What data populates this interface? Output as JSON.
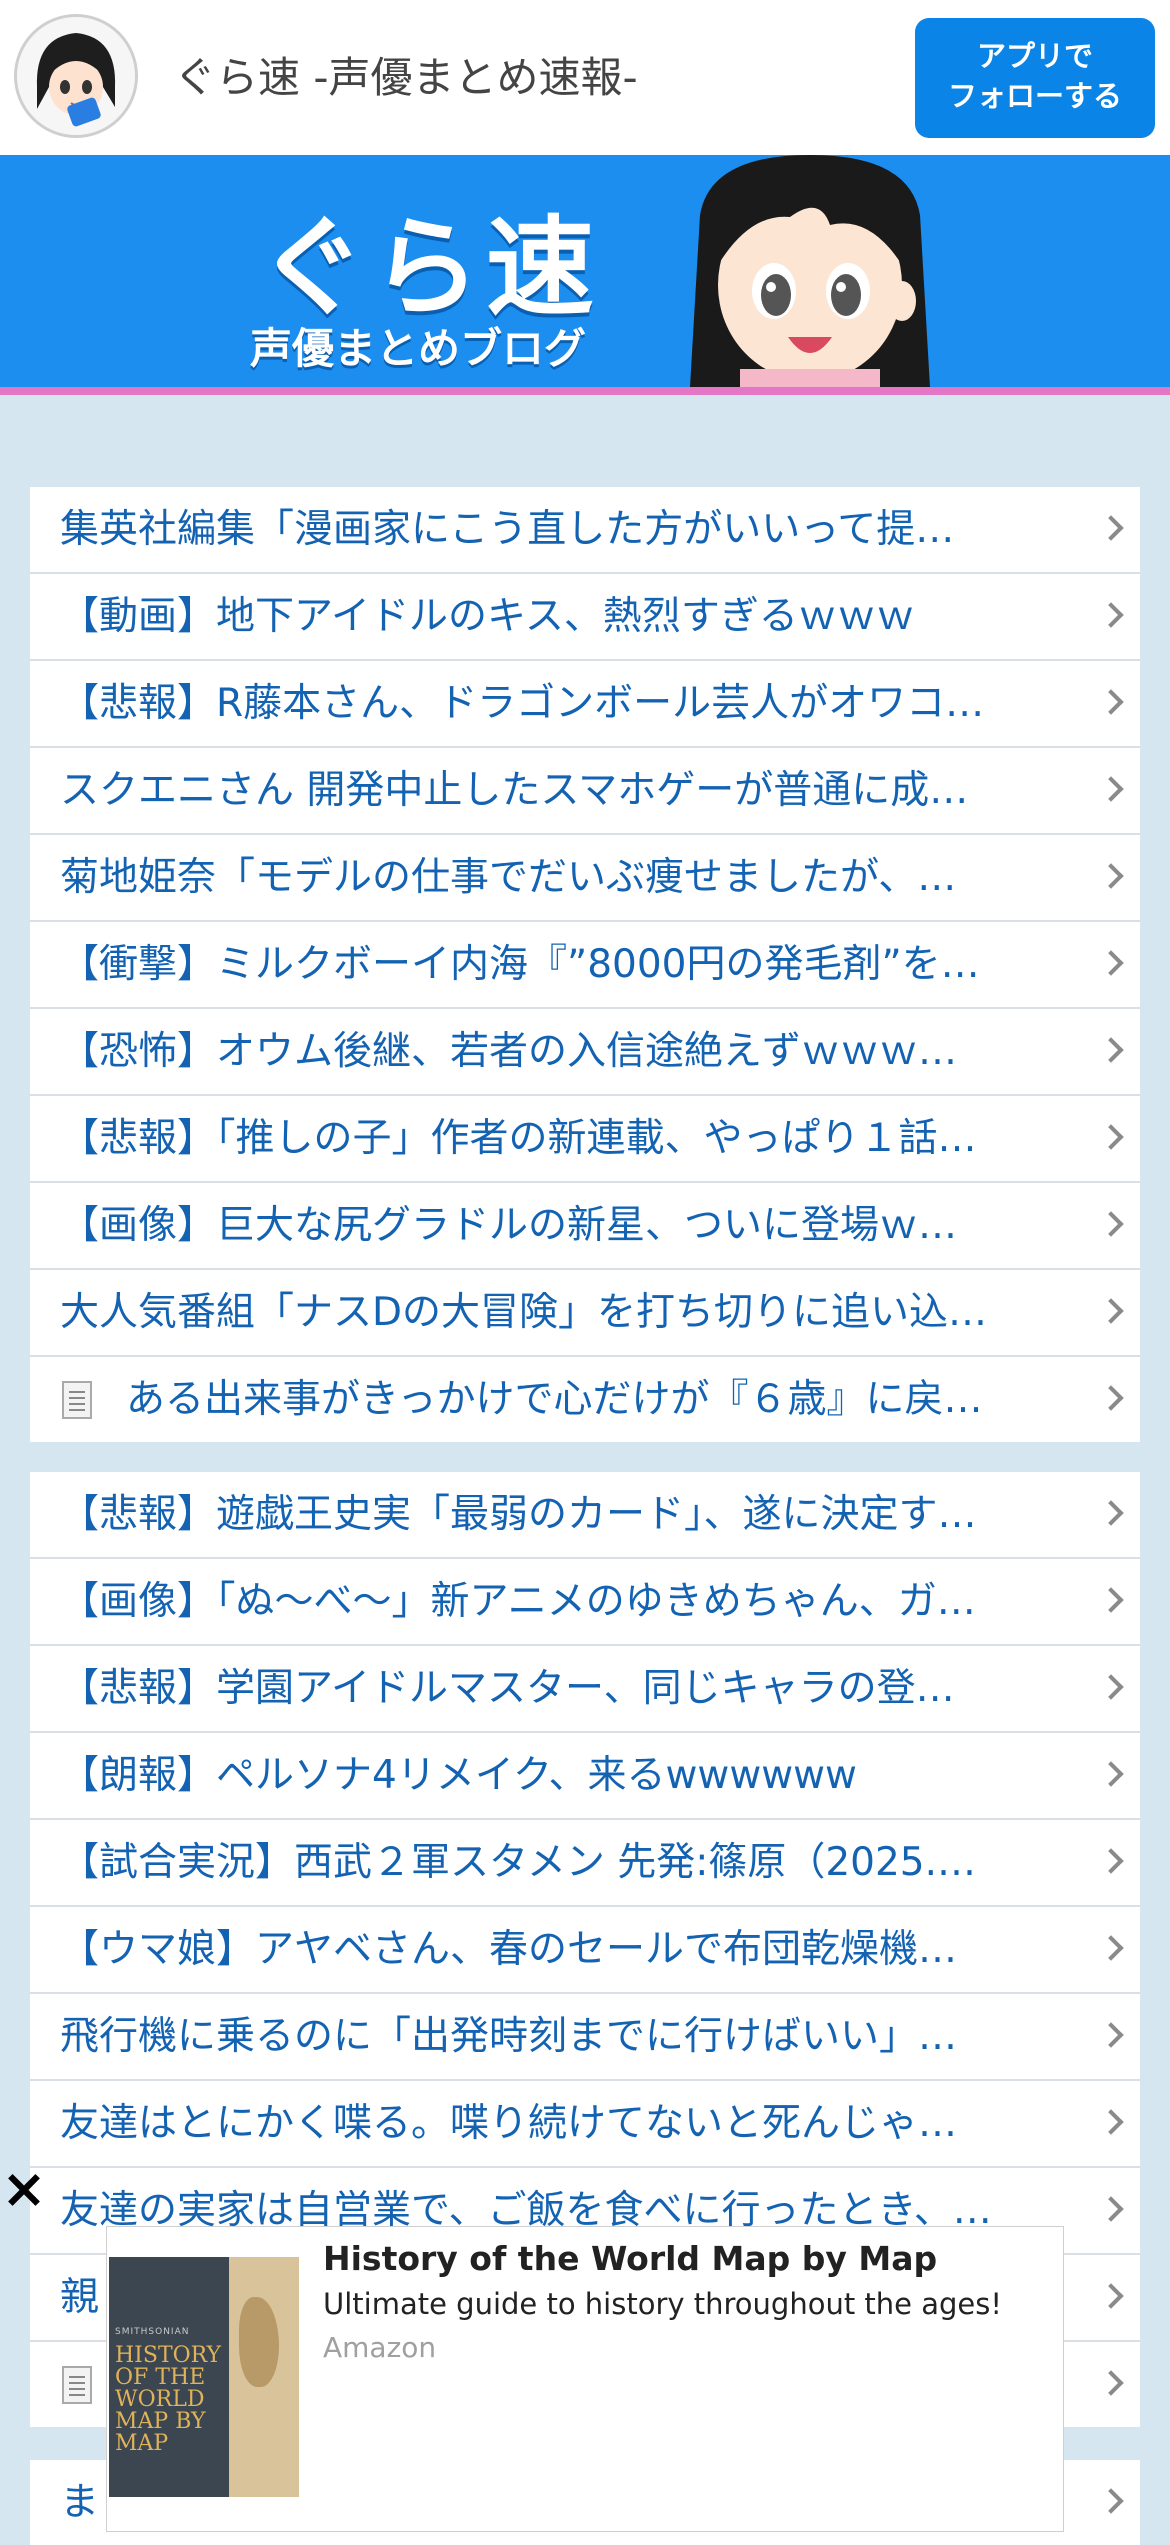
{
  "header": {
    "site_title": "ぐら速 -声優まとめ速報-",
    "follow_button": "アプリで\nフォローする",
    "follow_line1": "アプリで",
    "follow_line2": "フォローする"
  },
  "banner": {
    "logo_text": "ぐら速",
    "sub_text": "声優まとめブログ"
  },
  "list1": [
    {
      "title": "集英社編集「漫画家にこう直した方がいいって提…",
      "icon": ""
    },
    {
      "title": "【動画】地下アイドルのキス、熱烈すぎるｗｗｗ",
      "icon": ""
    },
    {
      "title": "【悲報】R藤本さん、ドラゴンボール芸人がオワコ…",
      "icon": ""
    },
    {
      "title": "スクエニさん 開発中止したスマホゲーが普通に成…",
      "icon": ""
    },
    {
      "title": "菊地姫奈「モデルの仕事でだいぶ痩せましたが、…",
      "icon": ""
    },
    {
      "title": "【衝撃】ミルクボーイ内海『”8000円の発毛剤”を…",
      "icon": ""
    },
    {
      "title": "【恐怖】オウム後継、若者の入信途絶えずｗｗｗ…",
      "icon": ""
    },
    {
      "title": "【悲報】「推しの子」作者の新連載、やっぱり１話…",
      "icon": ""
    },
    {
      "title": "【画像】巨大な尻グラドルの新星、ついに登場ｗ…",
      "icon": ""
    },
    {
      "title": "大人気番組「ナスDの大冒険」を打ち切りに追い込…",
      "icon": ""
    },
    {
      "title": "ある出来事がきっかけで心だけが『６歳』に戻…",
      "icon": "document-icon"
    }
  ],
  "list2": [
    {
      "title": "【悲報】遊戯王史実「最弱のカード」、遂に決定す…",
      "icon": ""
    },
    {
      "title": "【画像】「ぬ〜べ〜」新アニメのゆきめちゃん、ガ…",
      "icon": ""
    },
    {
      "title": "【悲報】学園アイドルマスター、同じキャラの登…",
      "icon": ""
    },
    {
      "title": "【朗報】ペルソナ4リメイク、来るwwwwww",
      "icon": ""
    },
    {
      "title": "【試合実況】西武２軍スタメン 先発:篠原（2025.…",
      "icon": ""
    },
    {
      "title": "【ウマ娘】アヤベさん、春のセールで布団乾燥機…",
      "icon": ""
    },
    {
      "title": "飛行機に乗るのに「出発時刻までに行けばいい」…",
      "icon": ""
    },
    {
      "title": "友達はとにかく喋る。喋り続けてないと死んじゃ…",
      "icon": ""
    },
    {
      "title": "友達の実家は自営業で、ご飯を食べに行ったとき、…",
      "icon": ""
    },
    {
      "title": "親",
      "icon": ""
    },
    {
      "title": "",
      "icon": "document-icon"
    }
  ],
  "list3": [
    {
      "title": "ま",
      "icon": ""
    }
  ],
  "ad": {
    "close_glyph": "×",
    "headline": "History of the World Map by Map",
    "description": "Ultimate guide to history throughout the ages!",
    "source": "Amazon",
    "book_small": "SMITHSONIAN",
    "book_title": "HISTORY OF THE WORLD MAP BY MAP"
  }
}
